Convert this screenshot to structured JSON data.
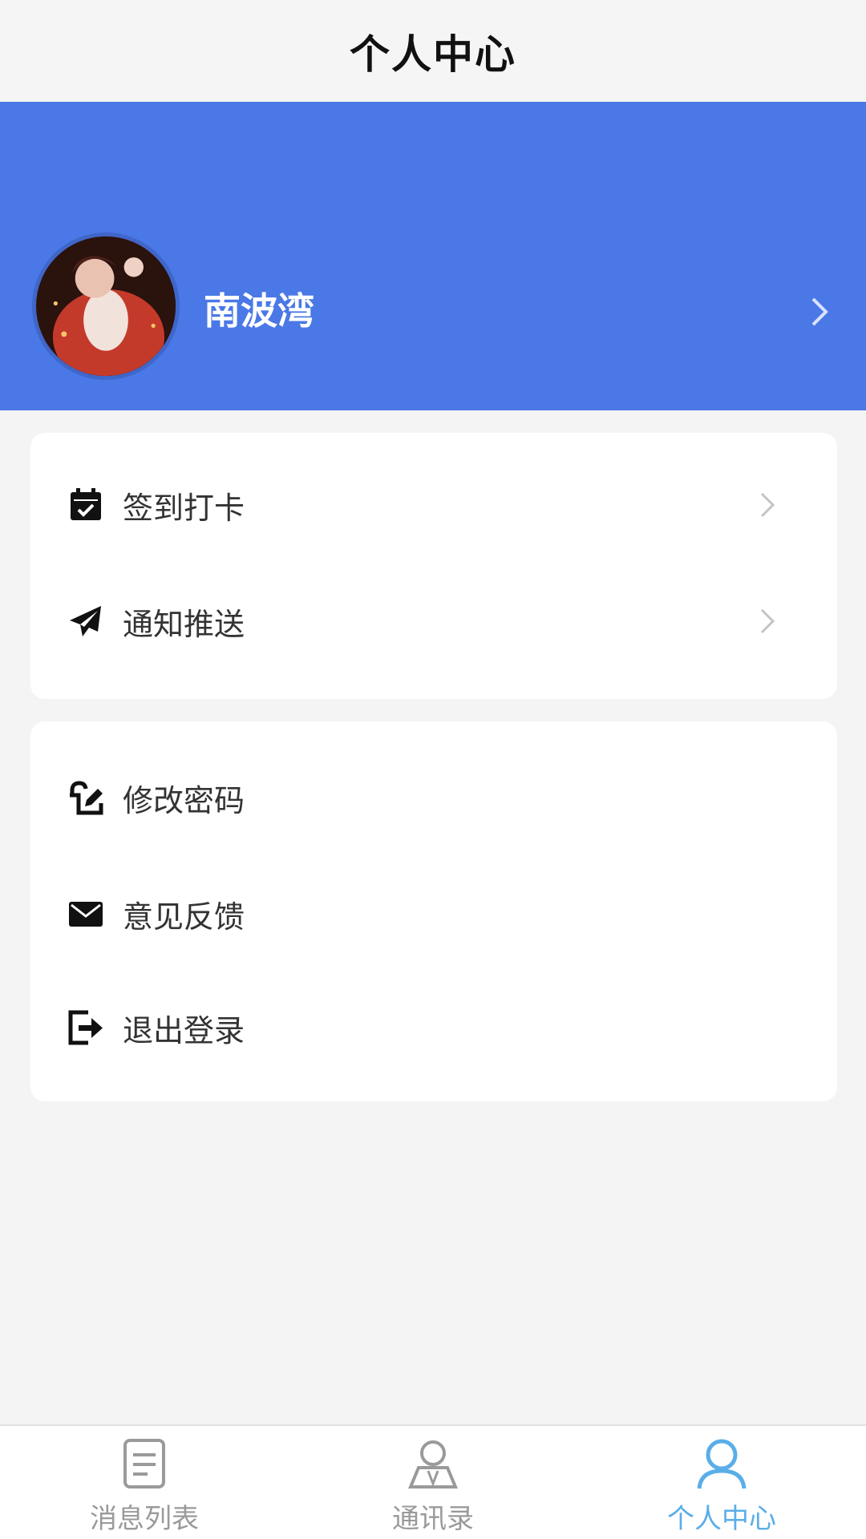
{
  "header": {
    "title": "个人中心"
  },
  "profile": {
    "name": "南波湾",
    "avatar_icon": "avatar-photo"
  },
  "menu_group_1": [
    {
      "label": "签到打卡",
      "icon": "calendar-check-icon",
      "has_chevron": true
    },
    {
      "label": "通知推送",
      "icon": "paper-plane-icon",
      "has_chevron": true
    }
  ],
  "menu_group_2": [
    {
      "label": "修改密码",
      "icon": "edit-lock-icon",
      "has_chevron": false
    },
    {
      "label": "意见反馈",
      "icon": "envelope-icon",
      "has_chevron": false
    },
    {
      "label": "退出登录",
      "icon": "sign-out-icon",
      "has_chevron": false
    }
  ],
  "tab_bar": [
    {
      "label": "消息列表",
      "icon": "document-list-icon",
      "active": false
    },
    {
      "label": "通讯录",
      "icon": "contacts-icon",
      "active": false
    },
    {
      "label": "个人中心",
      "icon": "user-icon",
      "active": true
    }
  ],
  "colors": {
    "brand_blue": "#4a78e6",
    "active_tab": "#5aaee8",
    "inactive_tab": "#9a9a9a",
    "page_bg": "#f4f4f4"
  }
}
